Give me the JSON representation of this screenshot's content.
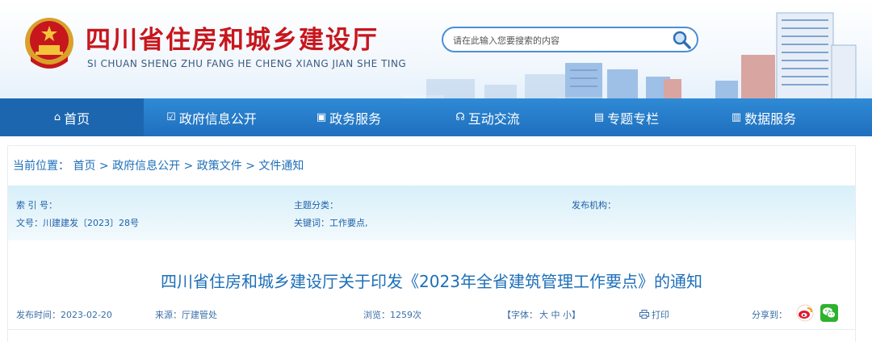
{
  "header": {
    "title": "四川省住房和城乡建设厅",
    "subtitle": "SI CHUAN SHENG ZHU FANG HE CHENG XIANG JIAN SHE TING",
    "search_placeholder": "请在此输入您要搜索的内容"
  },
  "nav": [
    {
      "label": "首页",
      "icon": "⌂",
      "icon_name": "home-icon",
      "active": true
    },
    {
      "label": "政府信息公开",
      "icon": "☑",
      "icon_name": "edit-icon"
    },
    {
      "label": "政务服务",
      "icon": "▣",
      "icon_name": "monitor-icon"
    },
    {
      "label": "互动交流",
      "icon": "☊",
      "icon_name": "chat-icon"
    },
    {
      "label": "专题专栏",
      "icon": "▤",
      "icon_name": "image-icon"
    },
    {
      "label": "数据服务",
      "icon": "▥",
      "icon_name": "chart-icon"
    }
  ],
  "breadcrumb": {
    "prefix": "当前位置：",
    "items": [
      "首页",
      "政府信息公开",
      "政策文件",
      "文件通知"
    ],
    "separator": ">"
  },
  "meta": {
    "index_label": "索 引 号：",
    "topic_label": "主题分类：",
    "publisher_label": "发布机构：",
    "doc_no": "文号：川建建发〔2023〕28号",
    "keywords": "关键词：工作要点,"
  },
  "article": {
    "title": "四川省住房和城乡建设厅关于印发《2023年全省建筑管理工作要点》的通知",
    "publish_time": "发布时间：2023-02-20",
    "source": "来源：厅建管处",
    "views": "浏览：1259次",
    "font_open": "【字体：",
    "font_large": "大",
    "font_medium": "中",
    "font_small": "小",
    "font_close": "】",
    "print": "打印",
    "share": "分享到："
  },
  "colors": {
    "title_red": "#c8161d",
    "nav_blue": "#2a7fcf",
    "link_blue": "#1d6fb8"
  }
}
